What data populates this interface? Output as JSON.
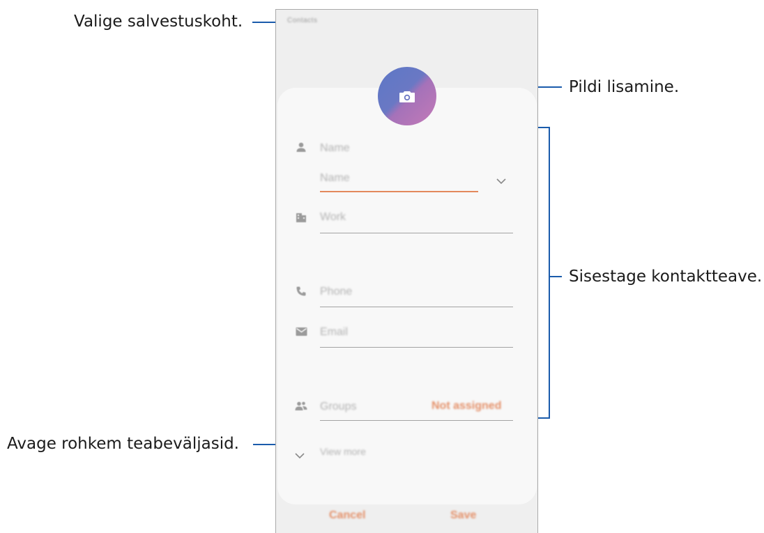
{
  "callouts": {
    "storage": "Valige salvestuskoht.",
    "picture": "Pildi lisamine.",
    "contact_info": "Sisestage kontaktteave.",
    "more_fields": "Avage rohkem teabeväljasid."
  },
  "screen": {
    "storage_location": "Contacts",
    "fields": {
      "name_header": "Name",
      "name_input_placeholder": "Name",
      "work_placeholder": "Work",
      "phone_placeholder": "Phone",
      "email_placeholder": "Email",
      "groups_label": "Groups",
      "groups_value": "Not assigned",
      "view_more": "View more"
    },
    "actions": {
      "cancel": "Cancel",
      "save": "Save"
    },
    "icons": {
      "photo": "camera-icon",
      "name": "person-icon",
      "work": "building-icon",
      "phone": "phone-icon",
      "email": "email-icon",
      "groups": "groups-icon",
      "expand": "chevron-down-icon",
      "view_more": "chevron-down-icon"
    },
    "colors": {
      "accent": "#e4916a",
      "photo_gradient_start": "#5d77c6",
      "photo_gradient_end": "#c47ab7",
      "callout_line": "#1a5bab"
    }
  }
}
